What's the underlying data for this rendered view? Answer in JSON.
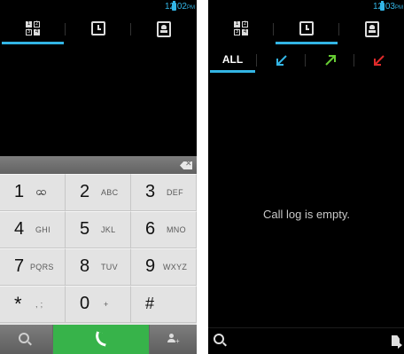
{
  "left_screen": {
    "status": {
      "time": "12:02",
      "ampm": "PM"
    },
    "tabs": [
      "dialpad",
      "call-log",
      "contacts"
    ],
    "active_tab": "dialpad",
    "backspace_glyph": "✕",
    "keys": [
      {
        "num": "1",
        "letters": ""
      },
      {
        "num": "2",
        "letters": "ABC"
      },
      {
        "num": "3",
        "letters": "DEF"
      },
      {
        "num": "4",
        "letters": "GHI"
      },
      {
        "num": "5",
        "letters": "JKL"
      },
      {
        "num": "6",
        "letters": "MNO"
      },
      {
        "num": "7",
        "letters": "PQRS"
      },
      {
        "num": "8",
        "letters": "TUV"
      },
      {
        "num": "9",
        "letters": "WXYZ"
      },
      {
        "num": "*",
        "letters": ", ;"
      },
      {
        "num": "0",
        "letters": "+"
      },
      {
        "num": "#",
        "letters": ""
      }
    ],
    "call_button_color": "#37b34a",
    "add_glyph": "+"
  },
  "right_screen": {
    "status": {
      "time": "12:03",
      "ampm": "PM"
    },
    "tabs": [
      "dialpad",
      "call-log",
      "contacts"
    ],
    "active_tab": "call-log",
    "filters": {
      "all_label": "ALL",
      "incoming_color": "#33b5e5",
      "outgoing_color": "#66cc33",
      "missed_color": "#e02a2a"
    },
    "empty_message": "Call log is empty."
  },
  "accent_color": "#33b5e5"
}
